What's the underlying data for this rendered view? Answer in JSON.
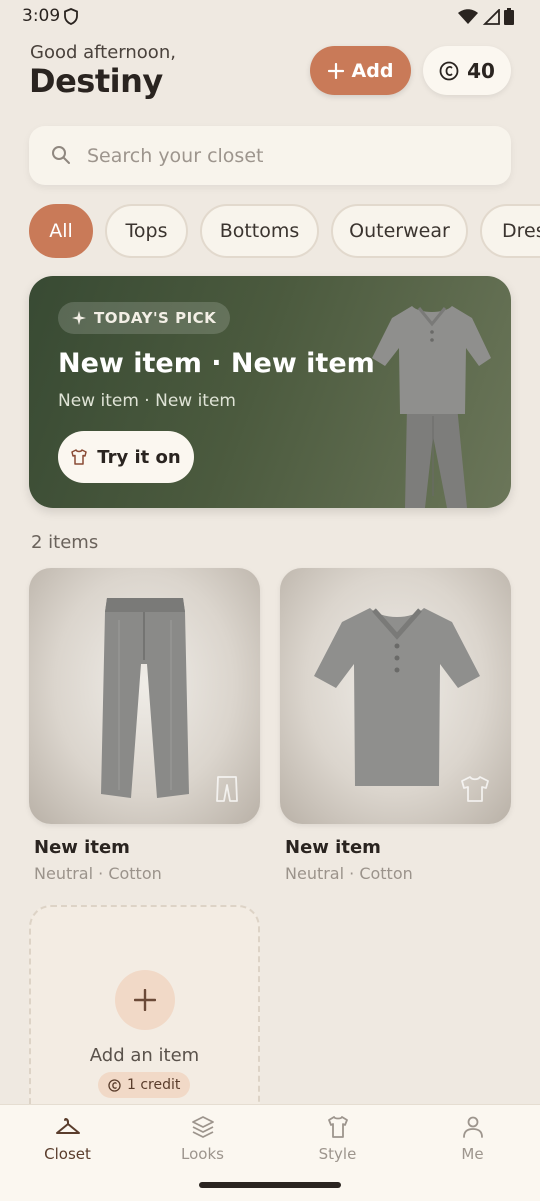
{
  "status_bar": {
    "time": "3:09"
  },
  "header": {
    "greeting": "Good afternoon,",
    "user_name": "Destiny",
    "add_label": "Add",
    "credits": "40"
  },
  "search": {
    "placeholder": "Search your closet"
  },
  "filters": {
    "chips": [
      "All",
      "Tops",
      "Bottoms",
      "Outerwear",
      "Dres"
    ],
    "selected": "All"
  },
  "todays_pick": {
    "badge": "TODAY'S PICK",
    "title": "New item · New item",
    "subtitle": "New item · New item",
    "button": "Try it on"
  },
  "closet": {
    "count_label": "2 items",
    "items": [
      {
        "name": "New item",
        "meta": "Neutral · Cotton",
        "type": "pants-icon"
      },
      {
        "name": "New item",
        "meta": "Neutral · Cotton",
        "type": "shirt-icon"
      }
    ],
    "add_card": {
      "label": "Add an item",
      "cost": "1 credit"
    }
  },
  "nav": {
    "items": [
      {
        "label": "Closet",
        "icon": "hanger-icon",
        "active": true
      },
      {
        "label": "Looks",
        "icon": "layers-icon",
        "active": false
      },
      {
        "label": "Style",
        "icon": "shirt-icon",
        "active": false
      },
      {
        "label": "Me",
        "icon": "person-icon",
        "active": false
      }
    ]
  },
  "colors": {
    "background": "#efe9e1",
    "accent": "#c97a58",
    "pick_card": "#4b5a3e",
    "text": "#2a2420"
  }
}
